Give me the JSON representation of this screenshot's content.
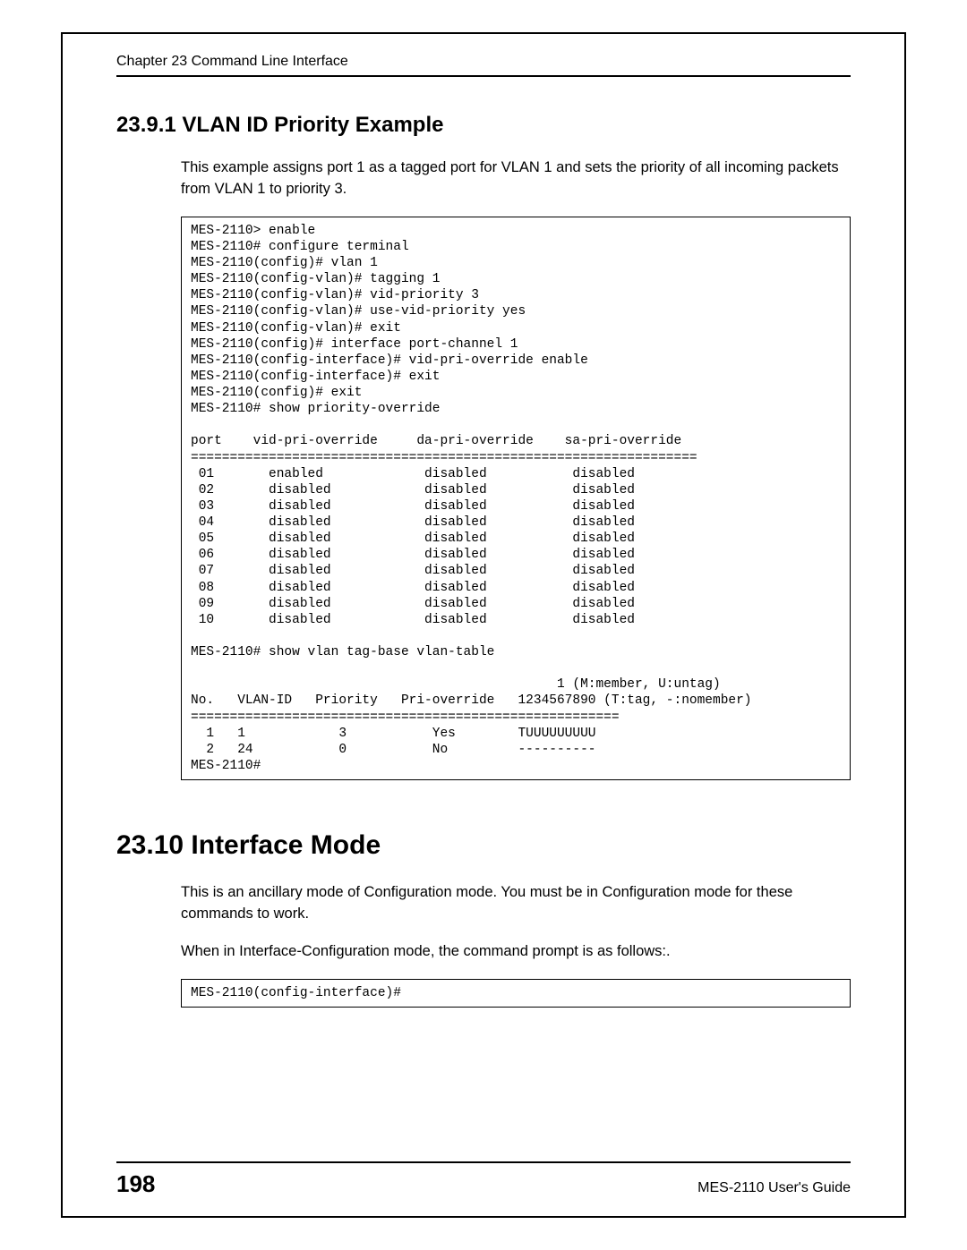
{
  "header": {
    "chapter": "Chapter 23 Command Line Interface"
  },
  "section1": {
    "heading": "23.9.1  VLAN ID Priority Example",
    "para": "This example assigns port 1 as a tagged port for VLAN 1 and sets the priority of all incoming packets from VLAN 1 to priority 3.",
    "code": "MES-2110> enable\nMES-2110# configure terminal\nMES-2110(config)# vlan 1\nMES-2110(config-vlan)# tagging 1\nMES-2110(config-vlan)# vid-priority 3\nMES-2110(config-vlan)# use-vid-priority yes\nMES-2110(config-vlan)# exit\nMES-2110(config)# interface port-channel 1\nMES-2110(config-interface)# vid-pri-override enable\nMES-2110(config-interface)# exit\nMES-2110(config)# exit\nMES-2110# show priority-override\n\nport    vid-pri-override     da-pri-override    sa-pri-override\n=================================================================\n 01       enabled             disabled           disabled\n 02       disabled            disabled           disabled\n 03       disabled            disabled           disabled\n 04       disabled            disabled           disabled\n 05       disabled            disabled           disabled\n 06       disabled            disabled           disabled\n 07       disabled            disabled           disabled\n 08       disabled            disabled           disabled\n 09       disabled            disabled           disabled\n 10       disabled            disabled           disabled\n\nMES-2110# show vlan tag-base vlan-table\n\n                                               1 (M:member, U:untag)\nNo.   VLAN-ID   Priority   Pri-override   1234567890 (T:tag, -:nomember)\n=======================================================\n  1   1            3           Yes        TUUUUUUUUU\n  2   24           0           No         ----------\nMES-2110#"
  },
  "section2": {
    "heading": "23.10  Interface Mode",
    "para1": "This is an ancillary mode of Configuration mode. You must be in Configuration mode for these commands to work.",
    "para2": "When in Interface-Configuration mode, the command prompt is as follows:.",
    "code": "MES-2110(config-interface)#"
  },
  "footer": {
    "page": "198",
    "guide": "MES-2110 User's Guide"
  }
}
